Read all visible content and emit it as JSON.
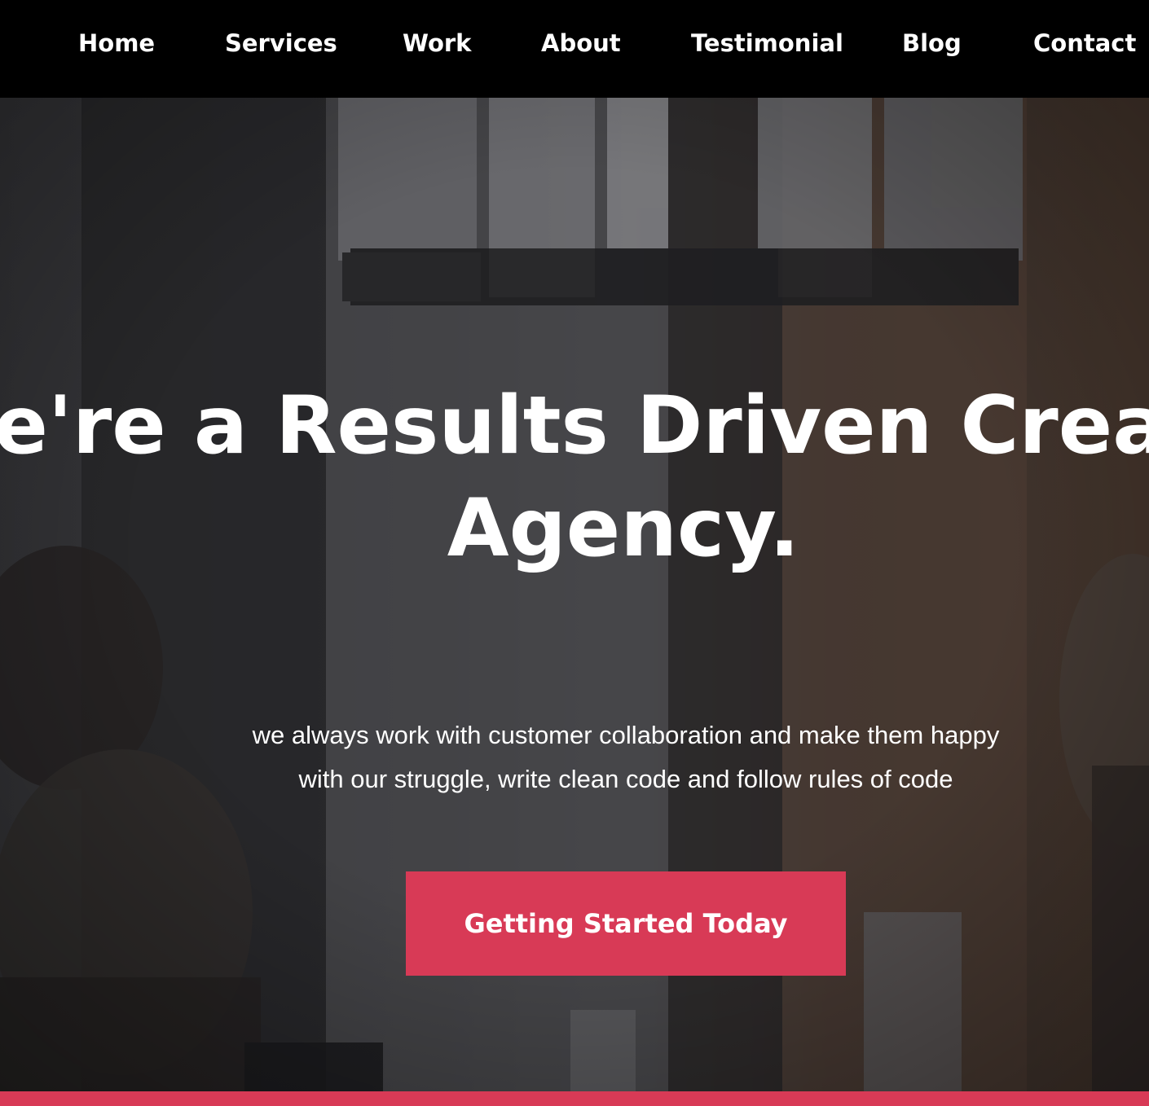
{
  "nav": {
    "items": [
      {
        "label": "Home"
      },
      {
        "label": "Services"
      },
      {
        "label": "Work"
      },
      {
        "label": "About"
      },
      {
        "label": "Testimonial"
      },
      {
        "label": "Blog"
      },
      {
        "label": "Contact"
      }
    ]
  },
  "hero": {
    "title_line1": "We're a Results Driven Creative",
    "title_line2": "Agency.",
    "subtitle_line1": "we always work with customer collaboration and make them happy",
    "subtitle_line2": "with our struggle, write clean code and follow rules of code",
    "cta_label": "Getting Started Today"
  },
  "colors": {
    "nav_background": "#000000",
    "accent": "#d83a56",
    "text": "#ffffff"
  }
}
